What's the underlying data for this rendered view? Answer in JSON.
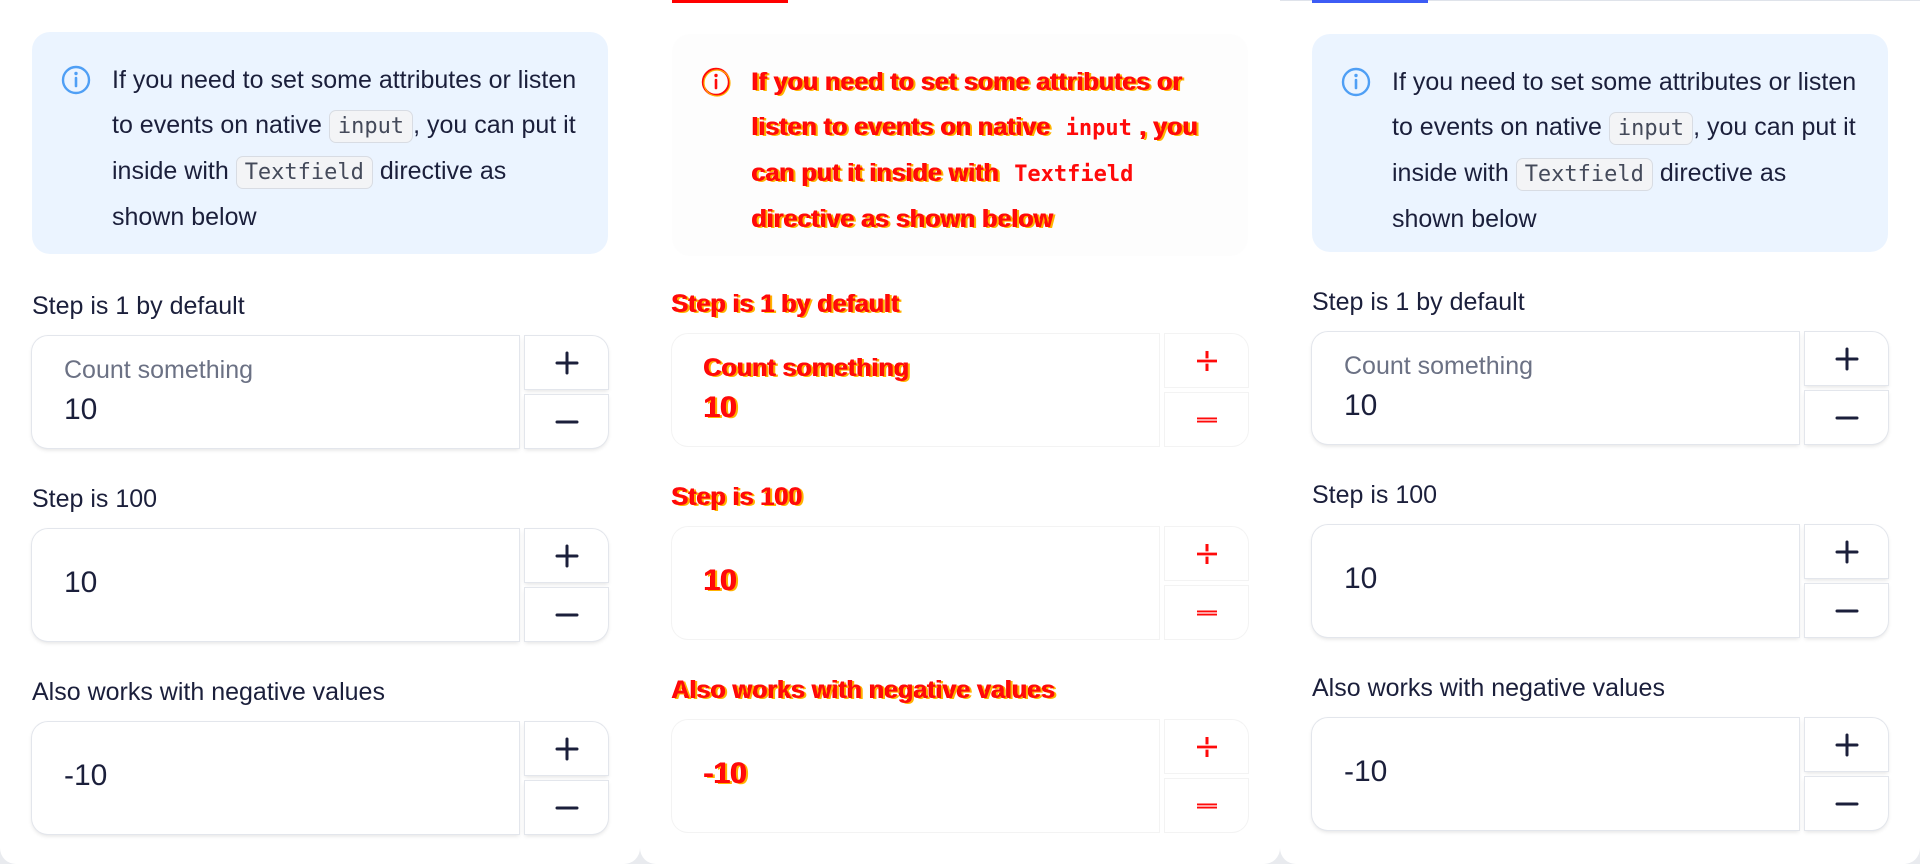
{
  "panels": [
    {
      "accent": "#ffffff",
      "callout": {
        "text1": "If you need to set some attributes or listen to events on native",
        "code1": "input",
        "text2": ", you can put it inside with",
        "code2": "Textfield",
        "text3": "directive as shown below"
      },
      "steppers": [
        {
          "label": "Step is 1 by default",
          "placeholder": "Count something",
          "value": "10",
          "plus_label": "+",
          "minus_label": "−"
        },
        {
          "label": "Step is 100",
          "placeholder": "",
          "value": "10",
          "plus_label": "+",
          "minus_label": "−"
        },
        {
          "label": "Also works with negative values",
          "placeholder": "",
          "value": "-10",
          "plus_label": "+",
          "minus_label": "−"
        }
      ]
    },
    {
      "accent": "#ff0000",
      "callout": {
        "text1": "If you need to set some attributes or listen to events on native",
        "code1": "input",
        "text2": ", you can put it inside with",
        "code2": "Textfield",
        "text3": "directive as shown below"
      },
      "steppers": [
        {
          "label": "Step is 1 by default",
          "placeholder": "Count something",
          "value": "10"
        },
        {
          "label": "Step is 100",
          "placeholder": "",
          "value": "10"
        },
        {
          "label": "Also works with negative values",
          "placeholder": "",
          "value": "-10"
        }
      ]
    },
    {
      "accent": "#3d5cf5",
      "callout": {
        "text1": "If you need to set some attributes or listen to events on native",
        "code1": "input",
        "text2": ", you can put it inside with",
        "code2": "Textfield",
        "text3": "directive as shown below"
      },
      "steppers": [
        {
          "label": "Step is 1 by default",
          "placeholder": "Count something",
          "value": "10"
        },
        {
          "label": "Step is 100",
          "placeholder": "",
          "value": "10"
        },
        {
          "label": "Also works with negative values",
          "placeholder": "",
          "value": "-10"
        }
      ]
    }
  ],
  "icons": {
    "info": "info-icon",
    "plus": "plus-icon",
    "minus": "minus-icon"
  },
  "colors": {
    "callout_bg": "#ebf4ff",
    "info_icon": "#4f9ff5",
    "text": "#1b1f3b",
    "placeholder": "#6b7184",
    "diff_red": "#ff0a0a",
    "diff_orange": "#ffb300"
  }
}
